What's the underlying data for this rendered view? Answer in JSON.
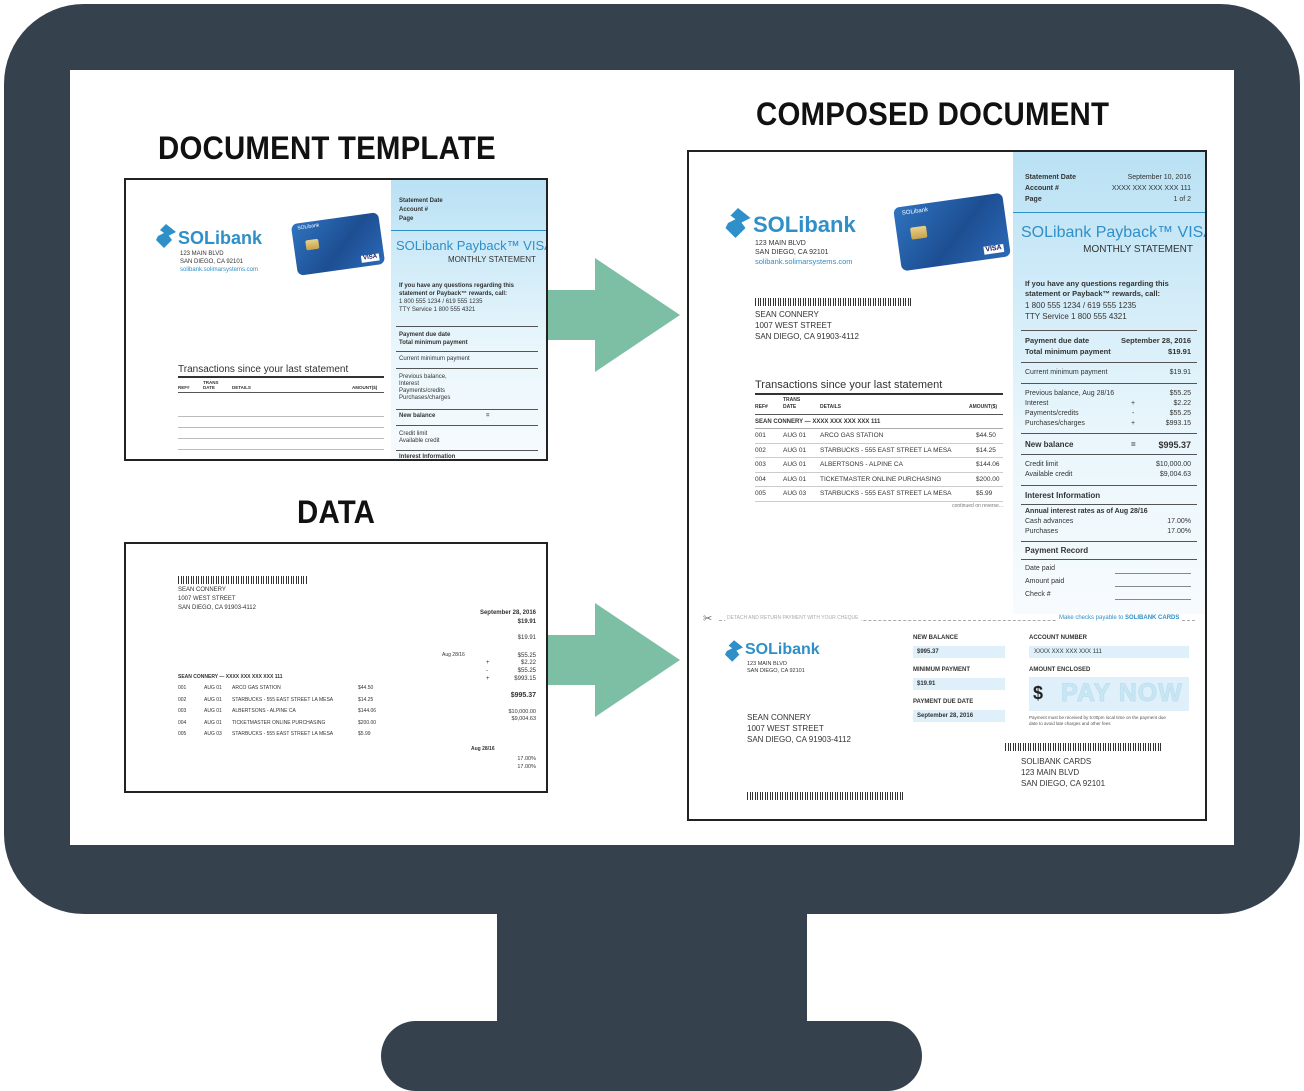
{
  "headings": {
    "template": "DOCUMENT TEMPLATE",
    "data": "DATA",
    "composed": "COMPOSED DOCUMENT"
  },
  "brand": {
    "logo": "SOLibank",
    "address1": "123 MAIN BLVD",
    "address2": "SAN DIEGO, CA 92101",
    "website": "solibank.solimarsystems.com",
    "product": "SOLibank Payback™ VISA",
    "statement_type": "MONTHLY STATEMENT"
  },
  "customer": {
    "name": "SEAN CONNERY",
    "street": "1007 WEST STREET",
    "city": "SAN DIEGO, CA 91903-4112"
  },
  "panel": {
    "statement_date_label": "Statement Date",
    "account_label": "Account #",
    "page_label": "Page",
    "statement_date": "September 10, 2016",
    "account": "XXXX XXX XXX XXX 111",
    "page": "1 of 2",
    "questions_1": "If you have any questions regarding this",
    "questions_2": "statement or Payback™ rewards, call:",
    "phone": "1 800 555 1234 / 619 555 1235",
    "tty": "TTY Service 1 800 555 4321",
    "due_date_label": "Payment due date",
    "due_date": "September 28, 2016",
    "total_min_label": "Total minimum payment",
    "total_min": "$19.91",
    "current_min_label": "Current minimum payment",
    "current_min": "$19.91",
    "prev_balance_label": "Previous balance, Aug 28/16",
    "prev_balance_label_short": "Previous balance,",
    "interest_label": "Interest",
    "payments_label": "Payments/credits",
    "purchases_label": "Purchases/charges",
    "prev_balance": "$55.25",
    "interest": "$2.22",
    "payments": "$55.25",
    "purchases": "$993.15",
    "new_balance_label": "New balance",
    "new_balance": "$995.37",
    "credit_limit_label": "Credit limit",
    "available_credit_label": "Available credit",
    "credit_limit": "$10,000.00",
    "available_credit": "$9,004.63",
    "interest_info_label": "Interest Information",
    "annual_rates_label": "Annual interest rates as of Aug 28/16",
    "cash_advances_label": "Cash advances",
    "purchases_rate_label": "Purchases",
    "cash_rate": "17.00%",
    "purchases_rate": "17.00%",
    "payment_record_label": "Payment Record",
    "date_paid_label": "Date paid",
    "amount_paid_label": "Amount paid",
    "check_label": "Check #",
    "plus": "+",
    "minus": "-",
    "equals": "="
  },
  "data_doc": {
    "date": "Aug 28/16"
  },
  "transactions": {
    "title": "Transactions since your last statement",
    "col_ref": "REF#",
    "col_trans_1": "TRANS",
    "col_trans_2": "DATE",
    "col_details": "DETAILS",
    "col_amount": "AMOUNT($)",
    "account_line": "SEAN CONNERY — XXXX XXX XXX XXX 111",
    "rows": [
      {
        "ref": "001",
        "date": "AUG 01",
        "details": "ARCO GAS STATION",
        "amount": "$44.50"
      },
      {
        "ref": "002",
        "date": "AUG 01",
        "details": "STARBUCKS - 555 EAST STREET LA MESA",
        "amount": "$14.25"
      },
      {
        "ref": "003",
        "date": "AUG 01",
        "details": "ALBERTSONS - ALPINE CA",
        "amount": "$144.06"
      },
      {
        "ref": "004",
        "date": "AUG 01",
        "details": "TICKETMASTER ONLINE PURCHASING",
        "amount": "$200.00"
      },
      {
        "ref": "005",
        "date": "AUG 03",
        "details": "STARBUCKS - 555 EAST STREET LA MESA",
        "amount": "$5.99"
      }
    ],
    "continued": "continued on reverse..."
  },
  "stub": {
    "detach": "DETACH AND RETURN PAYMENT WITH YOUR CHEQUE",
    "payable": "Make checks payable to",
    "payable_to": "SOLIBANK CARDS",
    "new_balance_label": "NEW BALANCE",
    "new_balance": "$995.37",
    "min_payment_label": "MINIMUM PAYMENT",
    "min_payment": "$19.91",
    "due_label": "PAYMENT DUE DATE",
    "due": "September 28, 2016",
    "account_label": "ACCOUNT NUMBER",
    "account": "XXXX XXX XXX XXX 111",
    "enclosed_label": "AMOUNT ENCLOSED",
    "dollar": "$",
    "pay_now": "PAY NOW",
    "note_1": "Payment must be received by 5:00pm local time on the payment due",
    "note_2": "date to avoid late charges and other fees",
    "remit_name": "SOLIBANK CARDS",
    "remit_street": "123 MAIN BLVD",
    "remit_city": "SAN DIEGO, CA 92101"
  },
  "colors": {
    "monitor": "#35414d",
    "arrow": "#7dbfa5",
    "brand_blue": "#2f8fc8",
    "panel_blue": "#b9e1f4"
  },
  "icons": {
    "arrow": "arrow-right-icon",
    "scissors": "scissors-icon"
  }
}
